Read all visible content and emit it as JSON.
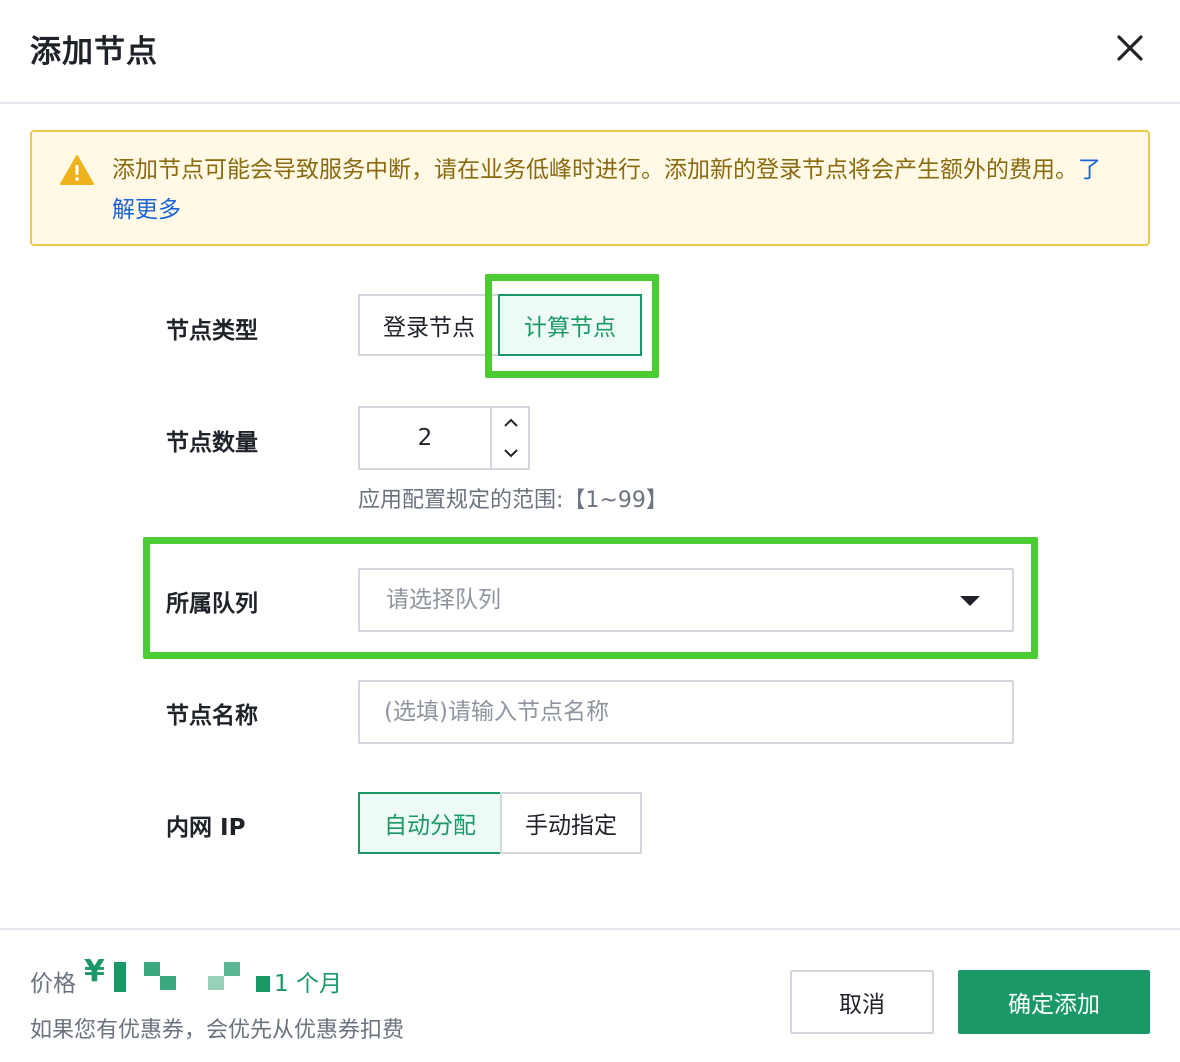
{
  "dialog": {
    "title": "添加节点"
  },
  "alert": {
    "text": "添加节点可能会导致服务中断，请在业务低峰时进行。添加新的登录节点将会产生额外的费用。",
    "link_label": "了解更多"
  },
  "form": {
    "node_type": {
      "label": "节点类型",
      "options": [
        "登录节点",
        "计算节点"
      ],
      "selected": "计算节点"
    },
    "node_count": {
      "label": "节点数量",
      "value": "2",
      "hint": "应用配置规定的范围:【1~99】"
    },
    "queue": {
      "label": "所属队列",
      "placeholder": "请选择队列"
    },
    "node_name": {
      "label": "节点名称",
      "placeholder": "(选填)请输入节点名称"
    },
    "private_ip": {
      "label": "内网 IP",
      "options": [
        "自动分配",
        "手动指定"
      ],
      "selected": "自动分配"
    }
  },
  "footer": {
    "price_label": "价格",
    "currency": "¥",
    "period": "1 个月",
    "coupon_note": "如果您有优惠券，会优先从优惠券扣费",
    "cancel_label": "取消",
    "confirm_label": "确定添加"
  },
  "colors": {
    "primary": "#1a9966",
    "warning_bg": "#fff9e5",
    "warning_border": "#f5c84c",
    "link": "#1b64d6",
    "highlight": "#4ccc33"
  }
}
